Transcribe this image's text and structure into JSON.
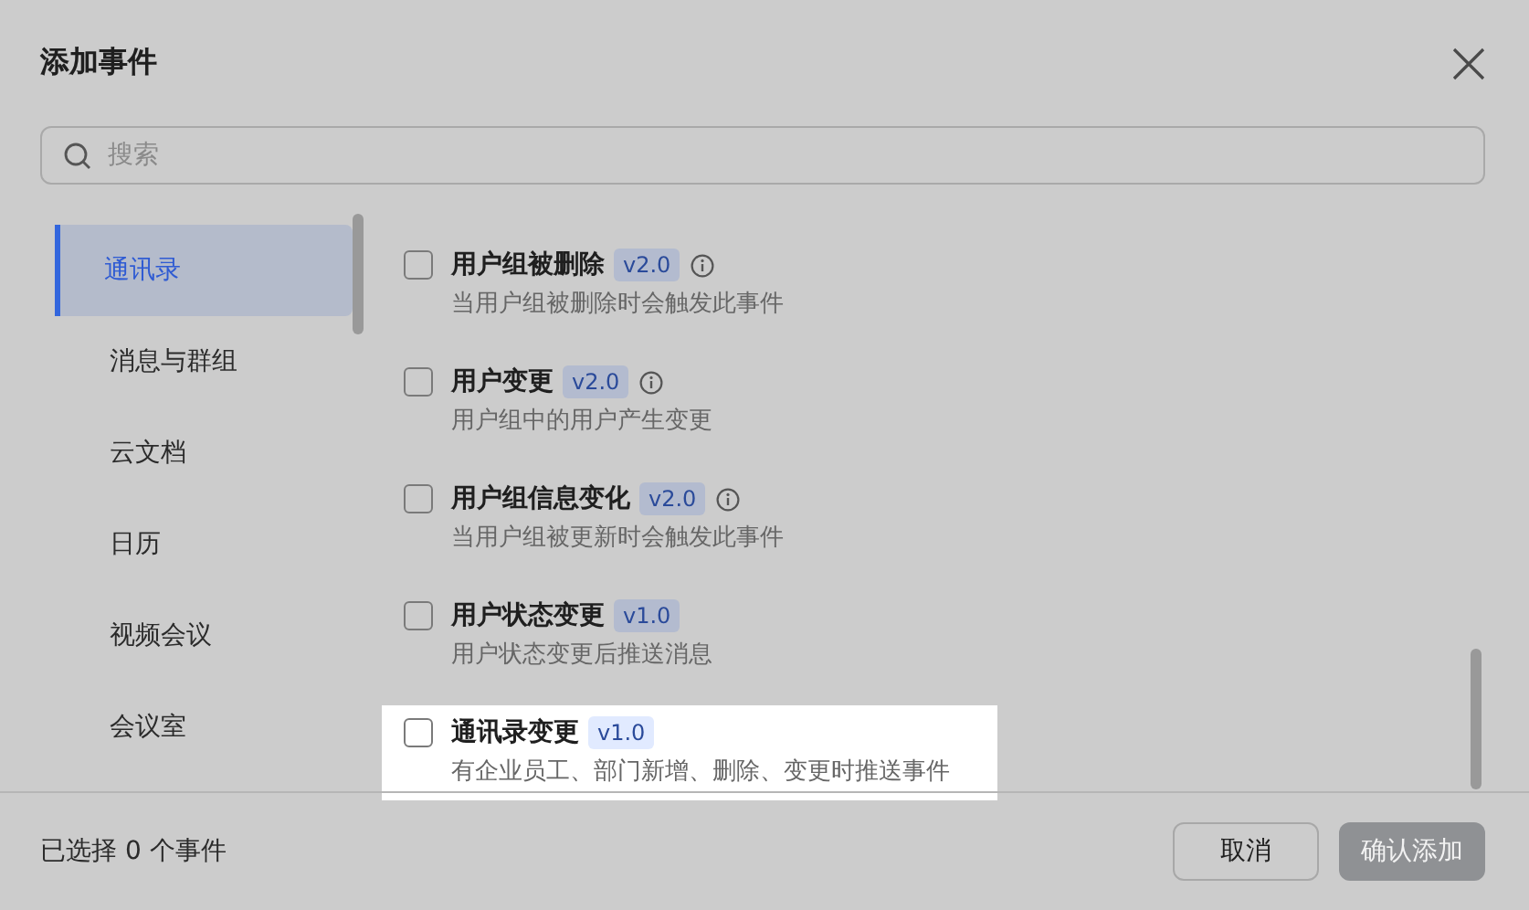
{
  "dialog": {
    "title": "添加事件"
  },
  "search": {
    "placeholder": "搜索"
  },
  "categories": [
    {
      "label": "通讯录",
      "selected": true
    },
    {
      "label": "消息与群组",
      "selected": false
    },
    {
      "label": "云文档",
      "selected": false
    },
    {
      "label": "日历",
      "selected": false
    },
    {
      "label": "视频会议",
      "selected": false
    },
    {
      "label": "会议室",
      "selected": false
    }
  ],
  "events": [
    {
      "name": "用户组被删除",
      "version": "v2.0",
      "info": true,
      "description": "当用户组被删除时会触发此事件",
      "checked": false,
      "highlighted": false
    },
    {
      "name": "用户变更",
      "version": "v2.0",
      "info": true,
      "description": "用户组中的用户产生变更",
      "checked": false,
      "highlighted": false
    },
    {
      "name": "用户组信息变化",
      "version": "v2.0",
      "info": true,
      "description": "当用户组被更新时会触发此事件",
      "checked": false,
      "highlighted": false
    },
    {
      "name": "用户状态变更",
      "version": "v1.0",
      "info": false,
      "description": "用户状态变更后推送消息",
      "checked": false,
      "highlighted": false
    },
    {
      "name": "通讯录变更",
      "version": "v1.0",
      "info": false,
      "description": "有企业员工、部门新增、删除、变更时推送事件",
      "checked": false,
      "highlighted": true
    }
  ],
  "footer": {
    "selection": "已选择 0 个事件",
    "buttons": [
      {
        "label": "取消",
        "kind": "secondary",
        "disabled": false
      },
      {
        "label": "确认添加",
        "kind": "primary",
        "disabled": true
      }
    ]
  }
}
